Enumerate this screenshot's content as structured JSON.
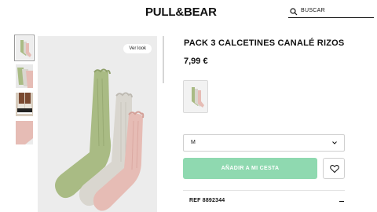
{
  "header": {
    "logo": "PULL&BEAR",
    "search_label": "BUSCAR"
  },
  "gallery": {
    "thumbnails": [
      "socks-pack",
      "socks-detail",
      "socks-worn",
      "socks-pink"
    ],
    "active_index": 0,
    "ver_look_label": "Ver look"
  },
  "product": {
    "title": "PACK 3 CALCETINES CANALÉ RIZOS",
    "price": "7,99 €",
    "size_selected": "M",
    "add_to_cart_label": "AÑADIR A MI CESTA",
    "reference": "REF 8892344"
  },
  "colors": {
    "cta_green": "#8fd9b0",
    "sock_green": "#a9bb84",
    "sock_grey": "#d9d6cf",
    "sock_pink": "#e6bcb5"
  }
}
